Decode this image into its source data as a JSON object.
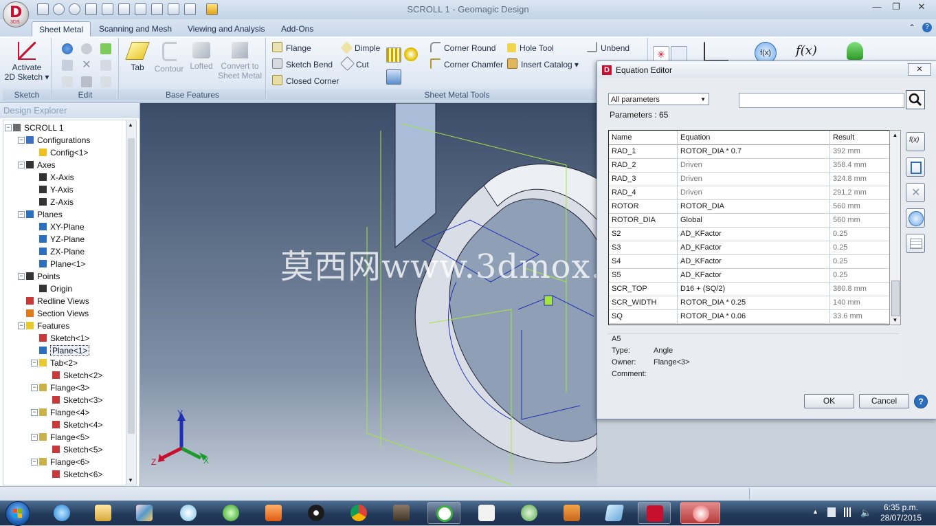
{
  "window": {
    "title": "SCROLL 1 - Geomagic Design",
    "logo": "D",
    "logo_sub": "3DS",
    "minimize": "—",
    "maximize": "❐",
    "close": "✕"
  },
  "ribbon_tabs": [
    "Sheet Metal",
    "Scanning and Mesh",
    "Viewing and Analysis",
    "Add-Ons"
  ],
  "ribbon": {
    "sketch": {
      "button": "Activate",
      "button2": "2D Sketch ▾",
      "label": "Sketch"
    },
    "edit": {
      "label": "Edit"
    },
    "base_features": {
      "label": "Base Features",
      "buttons": [
        "Tab",
        "Contour",
        "Lofted",
        "Convert to",
        "Sheet Metal"
      ]
    },
    "sheet_metal_tools": {
      "label": "Sheet Metal Tools",
      "items": [
        "Flange",
        "Sketch Bend",
        "Closed Corner",
        "Dimple",
        "Cut",
        "Corner Round",
        "Corner Chamfer",
        "Hole Tool",
        "Insert Catalog ▾",
        "Unbend"
      ]
    }
  },
  "explorer": {
    "title": "Design Explorer",
    "nodes": [
      {
        "label": "SCROLL 1"
      },
      {
        "label": "Configurations"
      },
      {
        "label": "Config<1>"
      },
      {
        "label": "Axes"
      },
      {
        "label": "X-Axis"
      },
      {
        "label": "Y-Axis"
      },
      {
        "label": "Z-Axis"
      },
      {
        "label": "Planes"
      },
      {
        "label": "XY-Plane"
      },
      {
        "label": "YZ-Plane"
      },
      {
        "label": "ZX-Plane"
      },
      {
        "label": "Plane<1>"
      },
      {
        "label": "Points"
      },
      {
        "label": "Origin"
      },
      {
        "label": "Redline Views"
      },
      {
        "label": "Section Views"
      },
      {
        "label": "Features"
      },
      {
        "label": "Sketch<1>"
      },
      {
        "label": "Plane<1>"
      },
      {
        "label": "Tab<2>"
      },
      {
        "label": "Sketch<2>"
      },
      {
        "label": "Flange<3>"
      },
      {
        "label": "Sketch<3>"
      },
      {
        "label": "Flange<4>"
      },
      {
        "label": "Sketch<4>"
      },
      {
        "label": "Flange<5>"
      },
      {
        "label": "Sketch<5>"
      },
      {
        "label": "Flange<6>"
      },
      {
        "label": "Sketch<6>"
      }
    ]
  },
  "viewport": {
    "watermark": "莫西网www.3dmox.com",
    "axis_x": "X",
    "axis_y": "Y",
    "axis_z": "Z"
  },
  "dialog": {
    "title": "Equation Editor",
    "close": "✕",
    "filter": "All parameters",
    "search_value": "",
    "params_count": "Parameters : 65",
    "columns": [
      "Name",
      "Equation",
      "Result"
    ],
    "rows": [
      [
        "RAD_1",
        "ROTOR_DIA * 0.7",
        "392 mm"
      ],
      [
        "RAD_2",
        "Driven",
        "358.4 mm"
      ],
      [
        "RAD_3",
        "Driven",
        "324.8 mm"
      ],
      [
        "RAD_4",
        "Driven",
        "291.2 mm"
      ],
      [
        "ROTOR",
        "ROTOR_DIA",
        "560 mm"
      ],
      [
        "ROTOR_DIA",
        "Global",
        "560 mm"
      ],
      [
        "S2",
        "AD_KFactor",
        "0.25"
      ],
      [
        "S3",
        "AD_KFactor",
        "0.25"
      ],
      [
        "S4",
        "AD_KFactor",
        "0.25"
      ],
      [
        "S5",
        "AD_KFactor",
        "0.25"
      ],
      [
        "SCR_TOP",
        "D16 + (SQ/2)",
        "380.8 mm"
      ],
      [
        "SCR_WIDTH",
        "ROTOR_DIA * 0.25",
        "140 mm"
      ],
      [
        "SQ",
        "ROTOR_DIA * 0.06",
        "33.6 mm"
      ]
    ],
    "info": {
      "heading": "A5",
      "type_label": "Type:",
      "type_value": "Angle",
      "owner_label": "Owner:",
      "owner_value": "Flange<3>",
      "comment_label": "Comment:",
      "comment_value": ""
    },
    "ok": "OK",
    "cancel": "Cancel",
    "help": "?"
  },
  "taskbar": {
    "time": "6:35 p.m.",
    "date": "28/07/2015"
  },
  "colors": {
    "accent_blue": "#2d6fbf",
    "brand_red": "#c8102e",
    "sketch_green": "#a6e63c",
    "sketch_blue": "#1f2fb5"
  }
}
